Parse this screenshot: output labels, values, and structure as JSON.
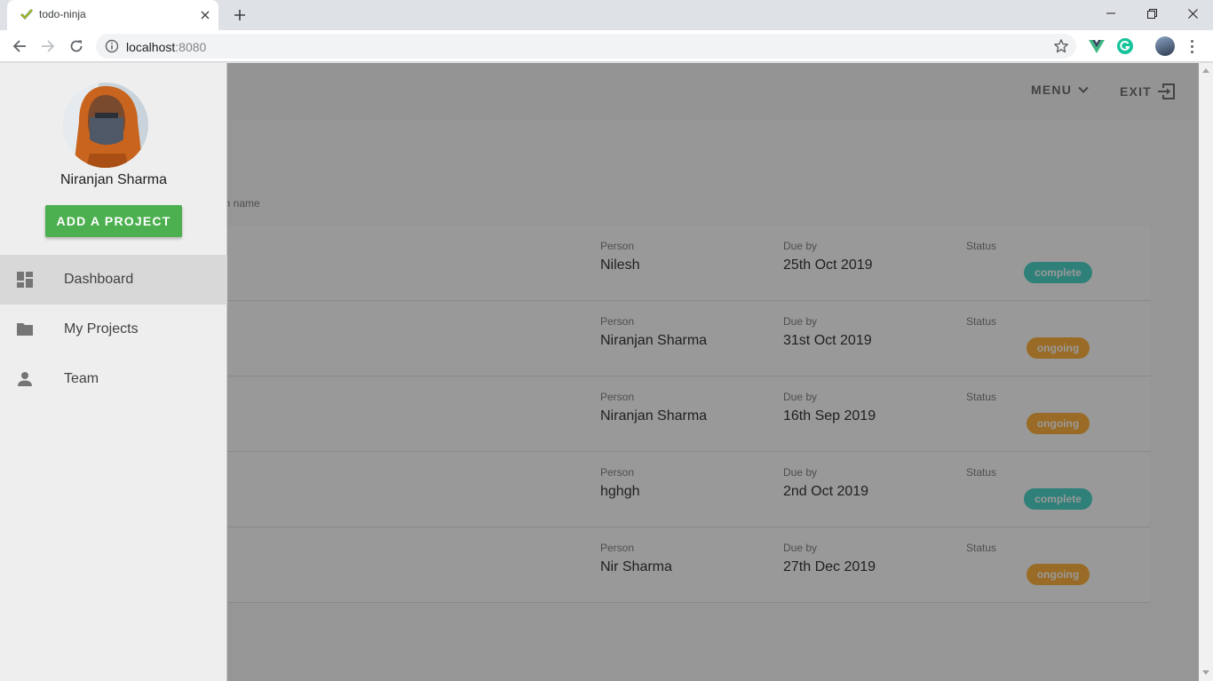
{
  "browser": {
    "tab_title": "todo-ninja",
    "url_host": "localhost",
    "url_port": ":8080"
  },
  "appbar": {
    "menu_label": "MENU",
    "exit_label": "EXIT"
  },
  "filter_hint": "son name",
  "drawer": {
    "user_name": "Niranjan Sharma",
    "add_project_label": "ADD A PROJECT",
    "nav": [
      {
        "label": "Dashboard",
        "icon": "dashboard-icon"
      },
      {
        "label": "My Projects",
        "icon": "folder-icon"
      },
      {
        "label": "Team",
        "icon": "person-icon"
      }
    ]
  },
  "columns": {
    "person": "Person",
    "due": "Due by",
    "status": "Status"
  },
  "projects": [
    {
      "person": "Nilesh",
      "due": "25th Oct 2019",
      "status": "complete"
    },
    {
      "person": "Niranjan Sharma",
      "due": "31st Oct 2019",
      "status": "ongoing"
    },
    {
      "person": "Niranjan Sharma",
      "due": "16th Sep 2019",
      "status": "ongoing"
    },
    {
      "person": "hghgh",
      "due": "2nd Oct 2019",
      "status": "complete"
    },
    {
      "person": "Nir Sharma",
      "due": "27th Dec 2019",
      "status": "ongoing"
    }
  ],
  "colors": {
    "complete": "#3cd1c2",
    "ongoing": "#ffaa2c",
    "add_button": "#4caf50"
  }
}
